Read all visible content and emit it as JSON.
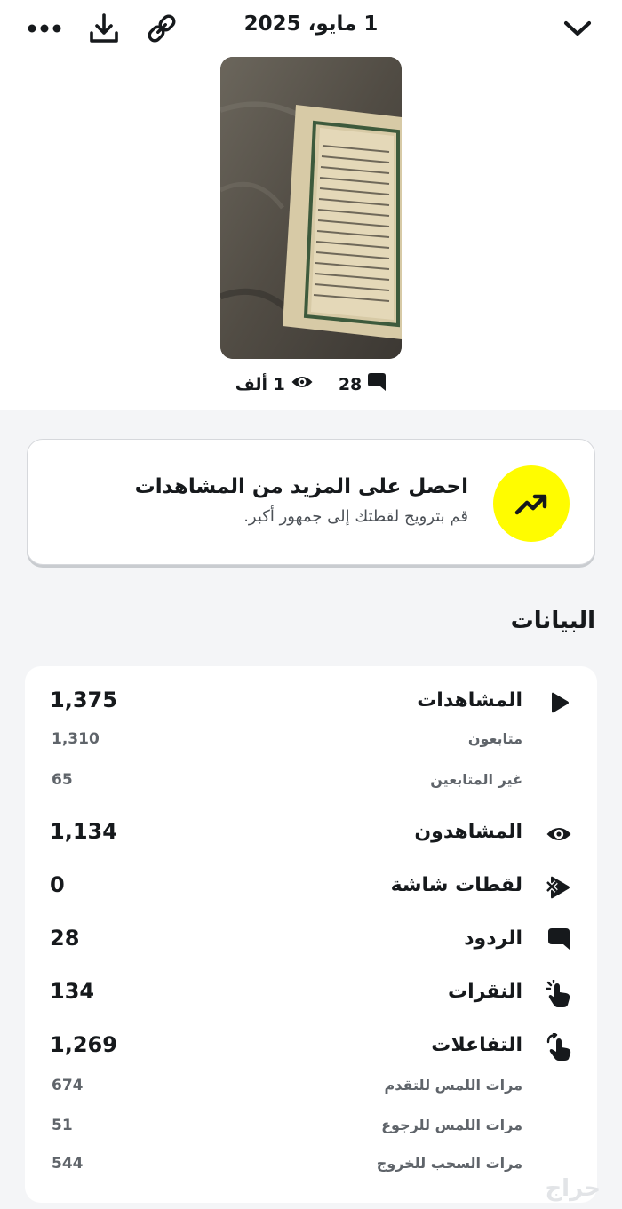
{
  "header": {
    "date": "1 مايو، 2025",
    "icons": [
      "more-icon",
      "download-icon",
      "link-icon",
      "chevron-down-icon"
    ]
  },
  "snap": {
    "views": "1 ألف",
    "replies": "28"
  },
  "promo": {
    "title": "احصل على المزيد من المشاهدات",
    "subtitle": "قم بترويج لقطتك إلى جمهور أكبر.",
    "accent": "#fffc00"
  },
  "insights": {
    "title": "البيانات",
    "views": {
      "label": "المشاهدات",
      "value": "1,375"
    },
    "followers": {
      "label": "متابعون",
      "value": "1,310"
    },
    "non_followers": {
      "label": "غير المتابعين",
      "value": "65"
    },
    "viewers": {
      "label": "المشاهدون",
      "value": "1,134"
    },
    "screenshots": {
      "label": "لقطات شاشة",
      "value": "0"
    },
    "replies": {
      "label": "الردود",
      "value": "28"
    },
    "taps": {
      "label": "النقرات",
      "value": "134"
    },
    "interactions": {
      "label": "التفاعلات",
      "value": "1,269"
    },
    "tap_forward": {
      "label": "مرات اللمس للتقدم",
      "value": "674"
    },
    "tap_back": {
      "label": "مرات اللمس للرجوع",
      "value": "51"
    },
    "swipe_out": {
      "label": "مرات السحب للخروج",
      "value": "544"
    }
  },
  "watermark": "حراج"
}
